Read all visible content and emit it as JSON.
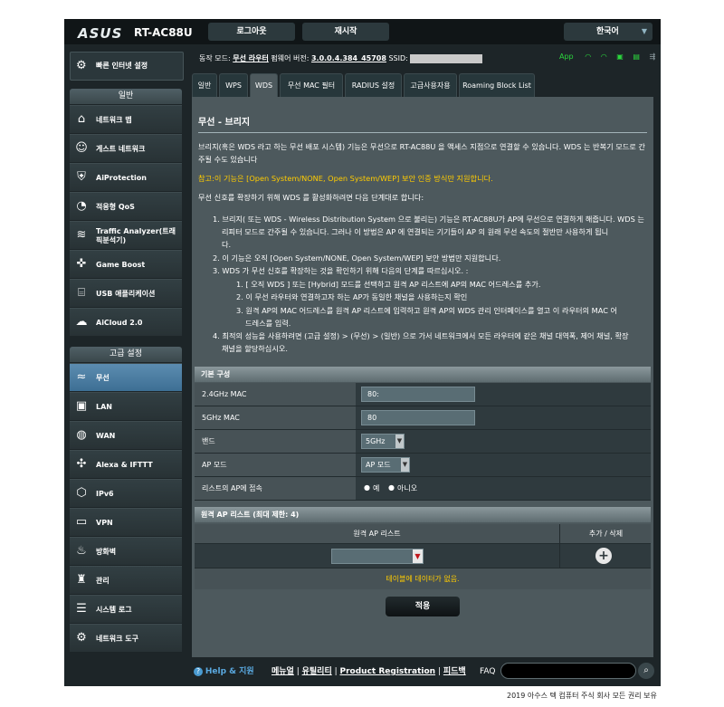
{
  "header": {
    "brand": "ASUS",
    "model": "RT-AC88U",
    "logout": "로그아웃",
    "reboot": "재시작",
    "language": "한국어"
  },
  "status": {
    "mode_label": "동작 모드:",
    "mode_value": "무선 라우터",
    "fw_label": "펌웨어 버전:",
    "fw_value": "3.0.0.4.384_45708",
    "ssid_label": "SSID:",
    "app_label": "App"
  },
  "sidebar": {
    "qis": "빠른 인터넷 설정",
    "general_header": "일반",
    "advanced_header": "고급 설정",
    "general": [
      {
        "label": "네트워크 맵",
        "icon": "network-map-icon",
        "glyph": "⌂"
      },
      {
        "label": "게스트 네트워크",
        "icon": "guest-network-icon",
        "glyph": "☺"
      },
      {
        "label": "AiProtection",
        "icon": "shield-icon",
        "glyph": "⛨"
      },
      {
        "label": "적응형 QoS",
        "icon": "qos-icon",
        "glyph": "◔"
      },
      {
        "label": "Traffic Analyzer(트래픽분석기)",
        "icon": "traffic-analyzer-icon",
        "glyph": "≋"
      },
      {
        "label": "Game Boost",
        "icon": "gamepad-icon",
        "glyph": "✜"
      },
      {
        "label": "USB 애플리케이션",
        "icon": "usb-icon",
        "glyph": "⌸"
      },
      {
        "label": "AiCloud 2.0",
        "icon": "cloud-icon",
        "glyph": "☁"
      }
    ],
    "advanced": [
      {
        "label": "무선",
        "icon": "wireless-icon",
        "glyph": "≈",
        "active": true
      },
      {
        "label": "LAN",
        "icon": "lan-icon",
        "glyph": "▣"
      },
      {
        "label": "WAN",
        "icon": "wan-globe-icon",
        "glyph": "◍"
      },
      {
        "label": "Alexa & IFTTT",
        "icon": "alexa-icon",
        "glyph": "✣"
      },
      {
        "label": "IPv6",
        "icon": "ipv6-icon",
        "glyph": "⬡"
      },
      {
        "label": "VPN",
        "icon": "vpn-icon",
        "glyph": "▭"
      },
      {
        "label": "방화벽",
        "icon": "firewall-icon",
        "glyph": "♨"
      },
      {
        "label": "관리",
        "icon": "administration-icon",
        "glyph": "♜"
      },
      {
        "label": "시스템 로그",
        "icon": "system-log-icon",
        "glyph": "☰"
      },
      {
        "label": "네트워크 도구",
        "icon": "network-tools-icon",
        "glyph": "⚙"
      }
    ]
  },
  "tabs": [
    {
      "label": "일반",
      "active": false
    },
    {
      "label": "WPS",
      "active": false
    },
    {
      "label": "WDS",
      "active": true
    },
    {
      "label": "무선 MAC 필터",
      "active": false
    },
    {
      "label": "RADIUS 설정",
      "active": false
    },
    {
      "label": "고급사용자용",
      "active": false
    },
    {
      "label": "Roaming Block List",
      "active": false
    }
  ],
  "content": {
    "title": "무선 - 브리지",
    "intro": "브리지(혹은 WDS 라고 하는 무선 배포 시스템) 기능은 무선으로 RT-AC88U 을 액세스 지점으로 연결할 수 있습니다. WDS 는 반복기 모드로 간주될 수도 있습니다",
    "note": "참고:이 기능은 [Open System/NONE, Open System/WEP] 보안 인증 방식만 지원합니다.",
    "steps_intro": "무선 신호를 확장하기 위해 WDS 를 활성화하려면 다음 단계대로 합니다:",
    "step1a": "1. 브리지( 또는 WDS - Wireless Distribution System 으로 불리는) 기능은 RT-AC88U가 AP에 무선으로 연결하게 해줍니다. WDS 는",
    "step1b": "리피터 모드로 간주될 수 있습니다. 그러나 이 방법은 AP 에 연결되는 기기들이 AP 의 원래 무선 속도의 절반만 사용하게 됩니",
    "step1c": "다.",
    "step2": "2. 이 기능은 오직 [Open System/NONE, Open System/WEP] 보안 방법만 지원합니다.",
    "step3": "3. WDS 가 무선 신호를 확장하는 것을 확인하기 위해 다음의 단계를 따르십시오. :",
    "sub1": "1. [ 오직 WDS ] 또는 [Hybrid] 모드를 선택하고 원격 AP 리스트에 AP의 MAC 어드레스를 추가.",
    "sub2": "2. 이 무선 라우터와 연결하고자 하는 AP가 동일한 채널을 사용하는지 확인",
    "sub3a": "3. 원격 AP의 MAC 어드레스를 원격 AP 리스트에 입력하고 원격 AP의 WDS 관리 인터페이스를 열고 이 라우터의 MAC 어",
    "sub3b": "드레스를 입력.",
    "step4a": "4. 최적의 성능을 사용하려면 (고급 설정) > (무선) > (일반) 으로 가서 네트워크에서 모든 라우터에 같은 채널 대역폭, 제어 채널, 확장",
    "step4b": "채널을 할당하십시오."
  },
  "basic": {
    "header": "기본 구성",
    "mac24_label": "2.4GHz MAC",
    "mac24_value": "80:",
    "mac5_label": "5GHz MAC",
    "mac5_value": "80",
    "band_label": "밴드",
    "band_value": "5GHz",
    "apmode_label": "AP 모드",
    "apmode_value": "AP 모드",
    "connect_label": "리스트의 AP에 접속",
    "yes": "예",
    "no": "아니오"
  },
  "remote": {
    "header": "원격 AP 리스트 (최대 제한: 4)",
    "col1": "원격 AP 리스트",
    "col2": "추가 / 삭제",
    "empty": "테이블에 데이터가 없음."
  },
  "apply": "적용",
  "footer": {
    "help": "Help & 지원",
    "manual": "메뉴얼",
    "utility": "유틸리티",
    "registration": "Product Registration",
    "feedback": "피드백",
    "faq": "FAQ",
    "copyright": "2019 아수스 텍 컴퓨터 주식 회사 모든 권리 보유"
  }
}
